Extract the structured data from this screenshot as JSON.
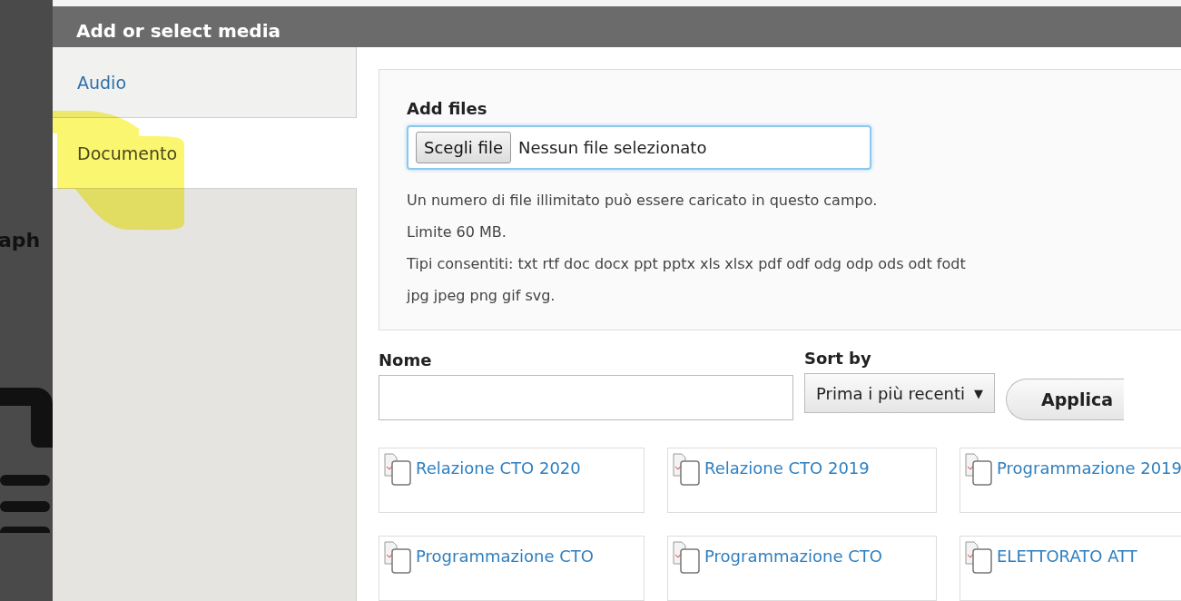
{
  "background": {
    "text": "aph"
  },
  "dialog": {
    "title": "Add or select media"
  },
  "tabs": [
    {
      "label": "Audio",
      "selected": false
    },
    {
      "label": "Documento",
      "selected": true
    }
  ],
  "upload": {
    "label": "Add files",
    "button": "Scegli file",
    "status": "Nessun file selezionato",
    "help": [
      "Un numero di file illimitato può essere caricato in questo campo.",
      "Limite 60 MB.",
      "Tipi consentiti: txt rtf doc docx ppt pptx xls xlsx pdf odf odg odp ods odt fodt",
      "jpg jpeg png gif svg."
    ]
  },
  "filters": {
    "name_label": "Nome",
    "sort_label": "Sort by",
    "sort_value": "Prima i più recenti",
    "sort_caret": "▼",
    "apply": "Applica"
  },
  "media": [
    {
      "title": "Relazione CTO 2020"
    },
    {
      "title": "Relazione CTO 2019"
    },
    {
      "title": "Programmazione 2019"
    },
    {
      "title": "Programmazione CTO"
    },
    {
      "title": "Programmazione CTO"
    },
    {
      "title": "ELETTORATO ATT"
    }
  ]
}
